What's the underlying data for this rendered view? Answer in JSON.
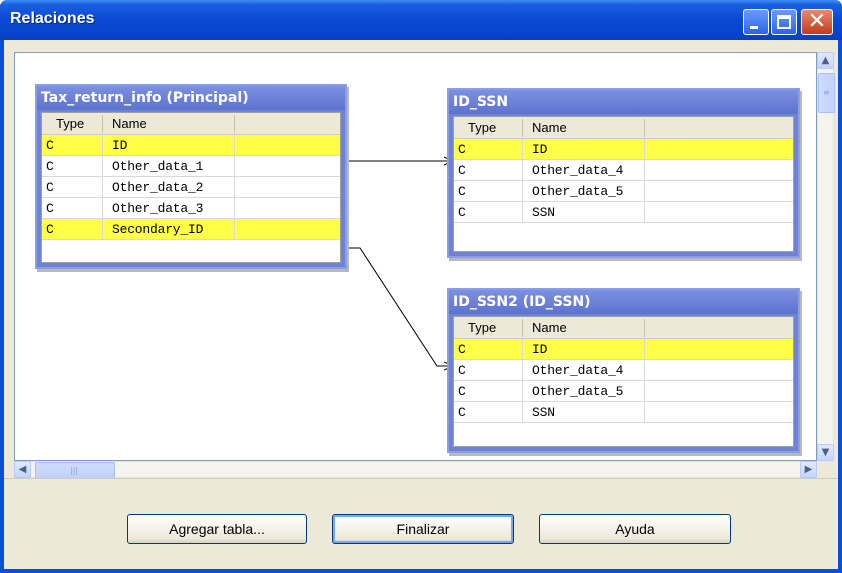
{
  "window": {
    "title": "Relaciones"
  },
  "title_buttons": {
    "minimize": "minimize-icon",
    "maximize": "maximize-icon",
    "close": "close-icon"
  },
  "tables": [
    {
      "title": "Tax_return_info (Principal)",
      "columns": [
        "Type",
        "Name"
      ],
      "rows": [
        {
          "type": "C",
          "name": "ID",
          "highlighted": true
        },
        {
          "type": "C",
          "name": "Other_data_1",
          "highlighted": false
        },
        {
          "type": "C",
          "name": "Other_data_2",
          "highlighted": false
        },
        {
          "type": "C",
          "name": "Other_data_3",
          "highlighted": false
        },
        {
          "type": "C",
          "name": "Secondary_ID",
          "highlighted": true
        }
      ]
    },
    {
      "title": "ID_SSN",
      "columns": [
        "Type",
        "Name"
      ],
      "rows": [
        {
          "type": "C",
          "name": "ID",
          "highlighted": true
        },
        {
          "type": "C",
          "name": "Other_data_4",
          "highlighted": false
        },
        {
          "type": "C",
          "name": "Other_data_5",
          "highlighted": false
        },
        {
          "type": "C",
          "name": "SSN",
          "highlighted": false
        }
      ]
    },
    {
      "title": "ID_SSN2 (ID_SSN)",
      "columns": [
        "Type",
        "Name"
      ],
      "rows": [
        {
          "type": "C",
          "name": "ID",
          "highlighted": true
        },
        {
          "type": "C",
          "name": "Other_data_4",
          "highlighted": false
        },
        {
          "type": "C",
          "name": "Other_data_5",
          "highlighted": false
        },
        {
          "type": "C",
          "name": "SSN",
          "highlighted": false
        }
      ]
    }
  ],
  "relations": [
    {
      "from": "Tax_return_info.ID",
      "to": "ID_SSN.ID"
    },
    {
      "from": "Tax_return_info.Secondary_ID",
      "to": "ID_SSN2.ID"
    }
  ],
  "buttons": {
    "add_table": "Agregar tabla...",
    "finish": "Finalizar",
    "help": "Ayuda"
  },
  "colors": {
    "title_bar": "#0a48d4",
    "table_header": "#6e82d6",
    "highlight": "#ffff45"
  }
}
